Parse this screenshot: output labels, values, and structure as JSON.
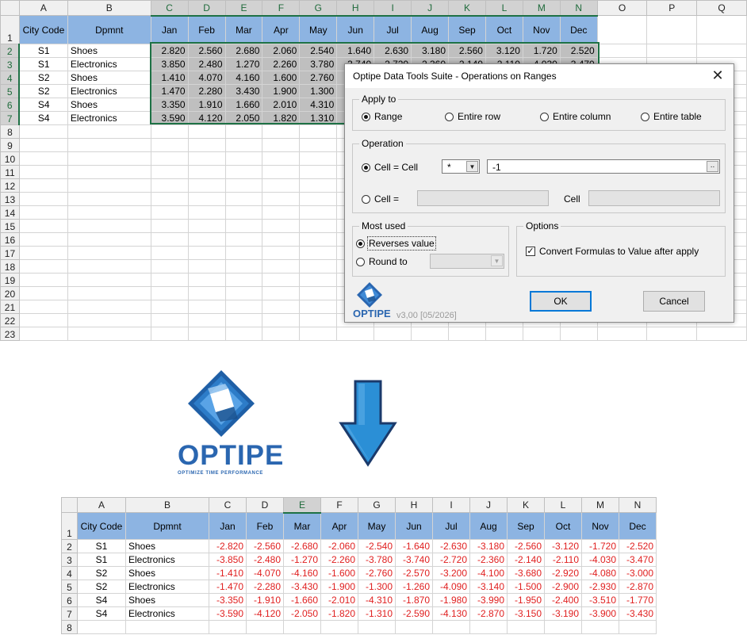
{
  "columns_top": [
    "A",
    "B",
    "C",
    "D",
    "E",
    "F",
    "G",
    "H",
    "I",
    "J",
    "K",
    "L",
    "M",
    "N",
    "O",
    "P",
    "Q"
  ],
  "columns_bottom": [
    "A",
    "B",
    "C",
    "D",
    "E",
    "F",
    "G",
    "H",
    "I",
    "J",
    "K",
    "L",
    "M",
    "N"
  ],
  "header_row": {
    "city": "City Code",
    "dept": "Dpmnt",
    "months": [
      "Jan",
      "Feb",
      "Mar",
      "Apr",
      "May",
      "Jun",
      "Jul",
      "Aug",
      "Sep",
      "Oct",
      "Nov",
      "Dec"
    ]
  },
  "rows_before": [
    {
      "city": "S1",
      "dept": "Shoes",
      "vals": [
        "2.820",
        "2.560",
        "2.680",
        "2.060",
        "2.540",
        "1.640",
        "2.630",
        "3.180",
        "2.560",
        "3.120",
        "1.720",
        "2.520"
      ]
    },
    {
      "city": "S1",
      "dept": "Electronics",
      "vals": [
        "3.850",
        "2.480",
        "1.270",
        "2.260",
        "3.780",
        "3.740",
        "2.720",
        "2.360",
        "2.140",
        "2.110",
        "4.030",
        "3.470"
      ]
    },
    {
      "city": "S2",
      "dept": "Shoes",
      "vals": [
        "1.410",
        "4.070",
        "4.160",
        "1.600",
        "2.760",
        "",
        "",
        "",
        "",
        "",
        "",
        ""
      ]
    },
    {
      "city": "S2",
      "dept": "Electronics",
      "vals": [
        "1.470",
        "2.280",
        "3.430",
        "1.900",
        "1.300",
        "",
        "",
        "",
        "",
        "",
        "",
        ""
      ]
    },
    {
      "city": "S4",
      "dept": "Shoes",
      "vals": [
        "3.350",
        "1.910",
        "1.660",
        "2.010",
        "4.310",
        "",
        "",
        "",
        "",
        "",
        "",
        ""
      ]
    },
    {
      "city": "S4",
      "dept": "Electronics",
      "vals": [
        "3.590",
        "4.120",
        "2.050",
        "1.820",
        "1.310",
        "",
        "",
        "",
        "",
        "",
        "",
        ""
      ]
    }
  ],
  "rows_after": [
    {
      "city": "S1",
      "dept": "Shoes",
      "vals": [
        "-2.820",
        "-2.560",
        "-2.680",
        "-2.060",
        "-2.540",
        "-1.640",
        "-2.630",
        "-3.180",
        "-2.560",
        "-3.120",
        "-1.720",
        "-2.520"
      ]
    },
    {
      "city": "S1",
      "dept": "Electronics",
      "vals": [
        "-3.850",
        "-2.480",
        "-1.270",
        "-2.260",
        "-3.780",
        "-3.740",
        "-2.720",
        "-2.360",
        "-2.140",
        "-2.110",
        "-4.030",
        "-3.470"
      ]
    },
    {
      "city": "S2",
      "dept": "Shoes",
      "vals": [
        "-1.410",
        "-4.070",
        "-4.160",
        "-1.600",
        "-2.760",
        "-2.570",
        "-3.200",
        "-4.100",
        "-3.680",
        "-2.920",
        "-4.080",
        "-3.000"
      ]
    },
    {
      "city": "S2",
      "dept": "Electronics",
      "vals": [
        "-1.470",
        "-2.280",
        "-3.430",
        "-1.900",
        "-1.300",
        "-1.260",
        "-4.090",
        "-3.140",
        "-1.500",
        "-2.900",
        "-2.930",
        "-2.870"
      ]
    },
    {
      "city": "S4",
      "dept": "Shoes",
      "vals": [
        "-3.350",
        "-1.910",
        "-1.660",
        "-2.010",
        "-4.310",
        "-1.870",
        "-1.980",
        "-3.990",
        "-1.950",
        "-2.400",
        "-3.510",
        "-1.770"
      ]
    },
    {
      "city": "S4",
      "dept": "Electronics",
      "vals": [
        "-3.590",
        "-4.120",
        "-2.050",
        "-1.820",
        "-1.310",
        "-2.590",
        "-4.130",
        "-2.870",
        "-3.150",
        "-3.190",
        "-3.900",
        "-3.430"
      ]
    }
  ],
  "dialog": {
    "title": "Optipe Data Tools Suite - Operations on Ranges",
    "close_glyph": "✕",
    "apply_to": {
      "legend": "Apply to",
      "options": [
        "Range",
        "Entire row",
        "Entire column",
        "Entire table"
      ],
      "selected": "Range"
    },
    "operation": {
      "legend": "Operation",
      "cell_eq_cell": "Cell = Cell",
      "operator": "*",
      "operand": "-1",
      "ellipsis": "..",
      "cell_eq": "Cell =",
      "cell_label": "Cell"
    },
    "most_used": {
      "legend": "Most used",
      "reverses": "Reverses value",
      "round_to": "Round to"
    },
    "options": {
      "legend": "Options",
      "convert": "Convert Formulas to Value after apply",
      "checked": true,
      "check_glyph": "✓"
    },
    "ok_label": "OK",
    "cancel_label": "Cancel",
    "logo_text": "OPTIPE",
    "version": "v3,00 [05/2026]"
  },
  "big_logo": {
    "name": "OPTIPE",
    "tagline": "OPTIMIZE TIME PERFORMANCE"
  },
  "colors": {
    "header_fill": "#8db4e2",
    "selection_fill": "#bfbfbf",
    "selection_border": "#1e7145",
    "negative_text": "#e02020",
    "brand_blue": "#2a66b0",
    "arrow_blue": "#2b8fd6"
  },
  "icons": {
    "dropdown": "▼",
    "logo": "optipe-logo-icon",
    "arrow": "down-arrow-icon"
  }
}
